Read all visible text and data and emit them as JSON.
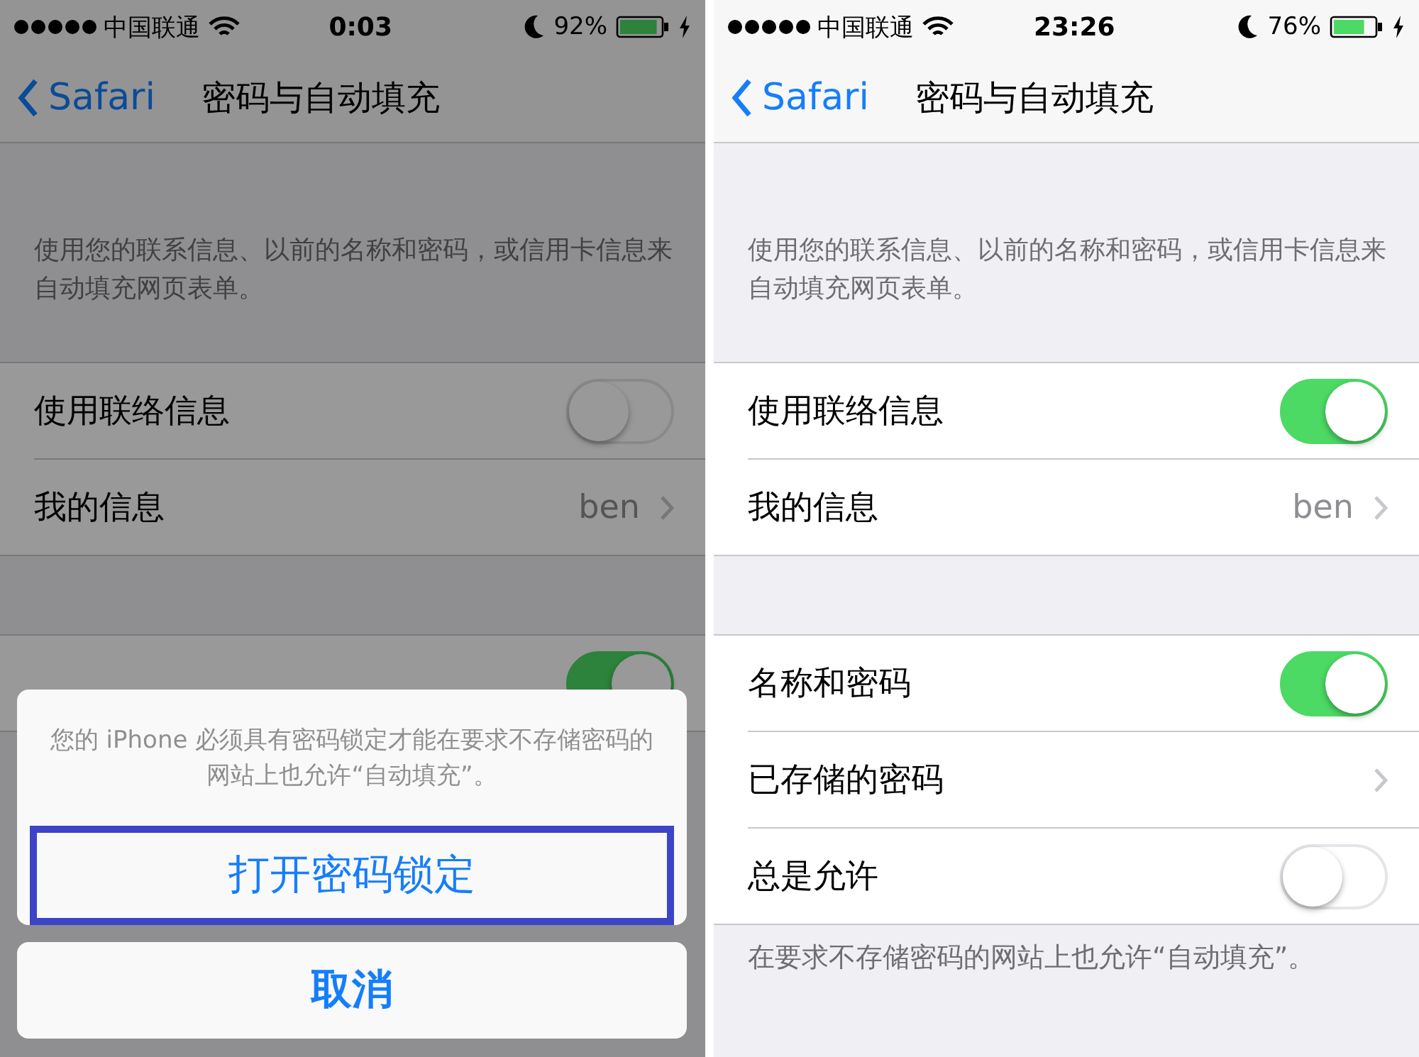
{
  "screens": [
    {
      "status_bar": {
        "carrier": "中国联通",
        "time": "0:03",
        "battery": "92%"
      },
      "nav": {
        "back": "Safari",
        "title": "密码与自动填充"
      },
      "header_note": "使用您的联系信息、以前的名称和密码，或信用卡信息来自动填充网页表单。",
      "groups": [
        [
          {
            "kind": "toggle",
            "label": "使用联络信息",
            "on": false
          },
          {
            "kind": "link",
            "label": "我的信息",
            "value": "ben"
          }
        ],
        [
          {
            "kind": "toggle",
            "on": true
          }
        ]
      ],
      "dimmed": true,
      "action_sheet": {
        "message": "您的 iPhone 必须具有密码锁定才能在要求不存储密码的网站上也允许“自动填充”。",
        "actions": [
          {
            "label": "打开密码锁定",
            "highlighted": true
          }
        ],
        "cancel": "取消"
      }
    },
    {
      "status_bar": {
        "carrier": "中国联通",
        "time": "23:26",
        "battery": "76%"
      },
      "nav": {
        "back": "Safari",
        "title": "密码与自动填充"
      },
      "header_note": "使用您的联系信息、以前的名称和密码，或信用卡信息来自动填充网页表单。",
      "groups": [
        [
          {
            "kind": "toggle",
            "label": "使用联络信息",
            "on": true
          },
          {
            "kind": "link",
            "label": "我的信息",
            "value": "ben"
          }
        ],
        [
          {
            "kind": "toggle",
            "label": "名称和密码",
            "on": true
          },
          {
            "kind": "link",
            "label": "已存储的密码"
          },
          {
            "kind": "toggle",
            "label": "总是允许",
            "on": false
          }
        ]
      ],
      "footer_note": "在要求不存储密码的网站上也允许“自动填充”。"
    }
  ]
}
